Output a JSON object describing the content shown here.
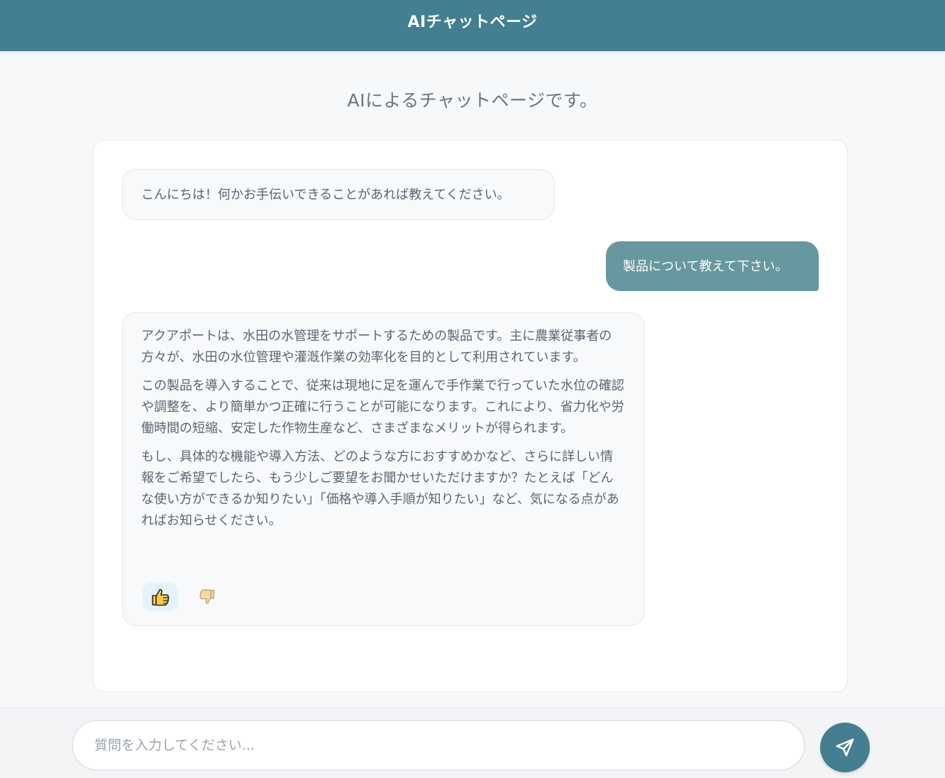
{
  "header": {
    "title": "AIチャットページ"
  },
  "subtitle": "AIによるチャットページです。",
  "messages": [
    {
      "role": "ai",
      "text": "こんにちは！何かお手伝いできることがあれば教えてください。"
    },
    {
      "role": "user",
      "text": "製品について教えて下さい。"
    },
    {
      "role": "ai",
      "paragraphs": [
        "アクアポートは、水田の水管理をサポートするための製品です。主に農業従事者の方々が、水田の水位管理や灌漑作業の効率化を目的として利用されています。",
        "この製品を導入することで、従来は現地に足を運んで手作業で行っていた水位の確認や調整を、より簡単かつ正確に行うことが可能になります。これにより、省力化や労働時間の短縮、安定した作物生産など、さまざまなメリットが得られます。",
        "もし、具体的な機能や導入方法、どのような方におすすめかなど、さらに詳しい情報をご希望でしたら、もう少しご要望をお聞かせいただけますか？たとえば「どんな使い方ができるか知りたい」「価格や導入手順が知りたい」など、気になる点があればお知らせください。"
      ],
      "feedback": {
        "thumbs_up_icon": "thumbs-up-icon",
        "thumbs_down_icon": "thumbs-down-icon",
        "selected": "up"
      }
    }
  ],
  "input": {
    "placeholder": "質問を入力してください...",
    "value": ""
  },
  "send_icon": "send-icon",
  "colors": {
    "header_bg": "#437f90",
    "user_bubble": "#67989f",
    "send_button": "#437f90"
  }
}
